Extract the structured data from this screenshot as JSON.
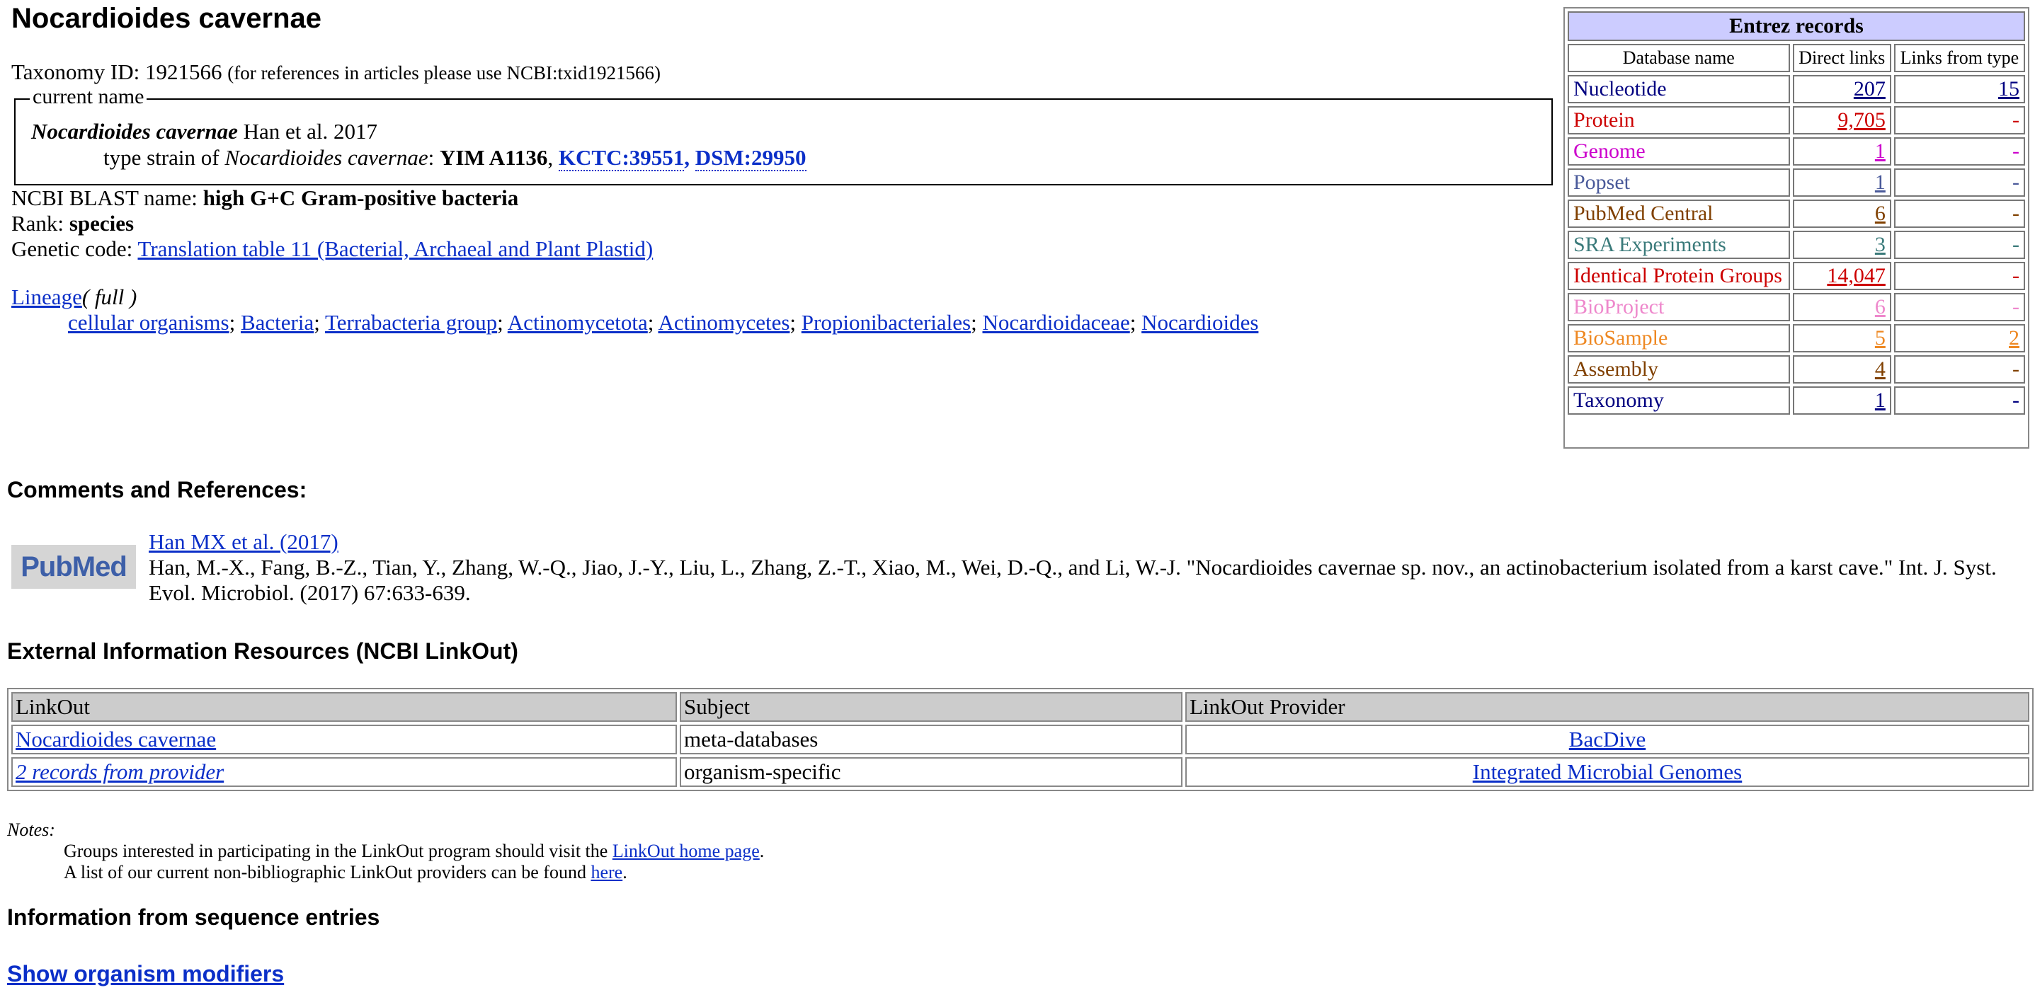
{
  "title": "Nocardioides cavernae",
  "taxonomy": {
    "id_label": "Taxonomy ID: 1921566",
    "ref_note": "(for references in articles please use NCBI:txid1921566)"
  },
  "current_name": {
    "legend": "current name",
    "name": "Nocardioides cavernae",
    "authority": "Han et al. 2017",
    "type_prefix": "type strain of",
    "type_name": "Nocardioides cavernae",
    "strain": "YIM A1136",
    "strain_links": [
      "KCTC:39551",
      "DSM:29950"
    ]
  },
  "blast": {
    "label": "NCBI BLAST name:",
    "value": "high G+C Gram-positive bacteria"
  },
  "rank": {
    "label": "Rank:",
    "value": "species"
  },
  "genetic_code": {
    "label": "Genetic code:",
    "value": "Translation table 11 (Bacterial, Archaeal and Plant Plastid)"
  },
  "lineage": {
    "label": "Lineage",
    "full": "( full )",
    "items": [
      "cellular organisms",
      "Bacteria",
      "Terrabacteria group",
      "Actinomycetota",
      "Actinomycetes",
      "Propionibacteriales",
      "Nocardioidaceae",
      "Nocardioides"
    ]
  },
  "entrez": {
    "title": "Entrez records",
    "headers": [
      "Database name",
      "Direct links",
      "Links from type"
    ],
    "rows": [
      {
        "name": "Nucleotide",
        "direct": "207",
        "from_type": "15",
        "color": "#000080"
      },
      {
        "name": "Protein",
        "direct": "9,705",
        "from_type": "-",
        "color": "#cc0000"
      },
      {
        "name": "Genome",
        "direct": "1",
        "from_type": "-",
        "color": "#cc00cc"
      },
      {
        "name": "Popset",
        "direct": "1",
        "from_type": "-",
        "color": "#4a5a9a"
      },
      {
        "name": "PubMed Central",
        "direct": "6",
        "from_type": "-",
        "color": "#804000"
      },
      {
        "name": "SRA Experiments",
        "direct": "3",
        "from_type": "-",
        "color": "#3a7a7a"
      },
      {
        "name": "Identical Protein Groups",
        "direct": "14,047",
        "from_type": "-",
        "color": "#cc0000"
      },
      {
        "name": "BioProject",
        "direct": "6",
        "from_type": "-",
        "color": "#ee88cc"
      },
      {
        "name": "BioSample",
        "direct": "5",
        "from_type": "2",
        "color": "#ee8822"
      },
      {
        "name": "Assembly",
        "direct": "4",
        "from_type": "-",
        "color": "#804000"
      },
      {
        "name": "Taxonomy",
        "direct": "1",
        "from_type": "-",
        "color": "#000080"
      }
    ]
  },
  "comments": {
    "heading": "Comments and References:",
    "logo_text": "PubMed",
    "ref_link": "Han MX et al. (2017)",
    "ref_text": "Han, M.-X., Fang, B.-Z., Tian, Y., Zhang, W.-Q., Jiao, J.-Y., Liu, L., Zhang, Z.-T., Xiao, M., Wei, D.-Q., and Li, W.-J. \"Nocardioides cavernae sp. nov., an actinobacterium isolated from a karst cave.\" Int. J. Syst. Evol. Microbiol. (2017) 67:633-639."
  },
  "external": {
    "heading": "External Information Resources (NCBI LinkOut)",
    "headers": [
      "LinkOut",
      "Subject",
      "LinkOut Provider"
    ],
    "rows": [
      {
        "linkout": "Nocardioides cavernae",
        "subject": "meta-databases",
        "provider": "BacDive",
        "italic": false
      },
      {
        "linkout": "2 records from provider",
        "subject": "organism-specific",
        "provider": "Integrated Microbial Genomes",
        "italic": true
      }
    ]
  },
  "notes": {
    "label": "Notes:",
    "line1_prefix": "Groups interested in participating in the LinkOut program should visit the ",
    "line1_link": "LinkOut home page",
    "line1_suffix": ".",
    "line2_prefix": "A list of our current non-bibliographic LinkOut providers can be found ",
    "line2_link": "here",
    "line2_suffix": "."
  },
  "sequence": {
    "heading": "Information from sequence entries",
    "show_modifiers": "Show organism modifiers"
  }
}
